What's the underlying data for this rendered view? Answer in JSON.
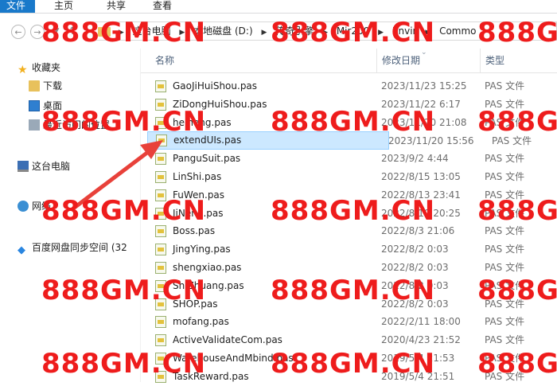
{
  "ribbon": {
    "tabs": [
      "文件",
      "主页",
      "共享",
      "查看"
    ]
  },
  "address": {
    "crumbs": [
      "这台电脑",
      "本地磁盘 (D:)",
      "传奇引擎",
      "Mir200",
      "Envir",
      "Commo"
    ]
  },
  "sidebar": {
    "favorites_label": "收藏夹",
    "downloads_label": "下载",
    "desktop_label": "桌面",
    "recent_label": "最近访问的位置",
    "this_pc_label": "这台电脑",
    "network_label": "网络",
    "baidu_label": "百度网盘同步空间 (32"
  },
  "columns": {
    "name": "名称",
    "date": "修改日期",
    "type": "类型"
  },
  "files": [
    {
      "name": "GaoJiHuiShou.pas",
      "date": "2023/11/23 15:25",
      "type": "PAS 文件"
    },
    {
      "name": "ZiDongHuiShou.pas",
      "date": "2023/11/22 6:17",
      "type": "PAS 文件"
    },
    {
      "name": "heiheng.pas",
      "date": "2023/11/20 21:08",
      "type": "PAS 文件"
    },
    {
      "name": "extendUIs.pas",
      "date": "2023/11/20 15:56",
      "type": "PAS 文件"
    },
    {
      "name": "PanguSuit.pas",
      "date": "2023/9/2 4:44",
      "type": "PAS 文件"
    },
    {
      "name": "LinShi.pas",
      "date": "2022/8/15 13:05",
      "type": "PAS 文件"
    },
    {
      "name": "FuWen.pas",
      "date": "2022/8/13 23:41",
      "type": "PAS 文件"
    },
    {
      "name": "JiNeng.pas",
      "date": "2022/8/10 20:25",
      "type": "PAS 文件"
    },
    {
      "name": "Boss.pas",
      "date": "2022/8/3 21:06",
      "type": "PAS 文件"
    },
    {
      "name": "JingYing.pas",
      "date": "2022/8/2 0:03",
      "type": "PAS 文件"
    },
    {
      "name": "shengxiao.pas",
      "date": "2022/8/2 0:03",
      "type": "PAS 文件"
    },
    {
      "name": "ShiZhuang.pas",
      "date": "2022/8/2 0:03",
      "type": "PAS 文件"
    },
    {
      "name": "SHOP.pas",
      "date": "2022/8/2 0:03",
      "type": "PAS 文件"
    },
    {
      "name": "mofang.pas",
      "date": "2022/2/11 18:00",
      "type": "PAS 文件"
    },
    {
      "name": "ActiveValidateCom.pas",
      "date": "2020/4/23 21:52",
      "type": "PAS 文件"
    },
    {
      "name": "WarehouseAndMbind.pas",
      "date": "2019/5/4 21:53",
      "type": "PAS 文件"
    },
    {
      "name": "TaskReward.pas",
      "date": "2019/5/4 21:51",
      "type": "PAS 文件"
    }
  ],
  "watermark_text": "888GM.CN",
  "colors": {
    "file_tab": "#1979ca",
    "selection": "#cce8ff",
    "watermark": "#ee1c1c",
    "arrow": "#e8413a"
  }
}
